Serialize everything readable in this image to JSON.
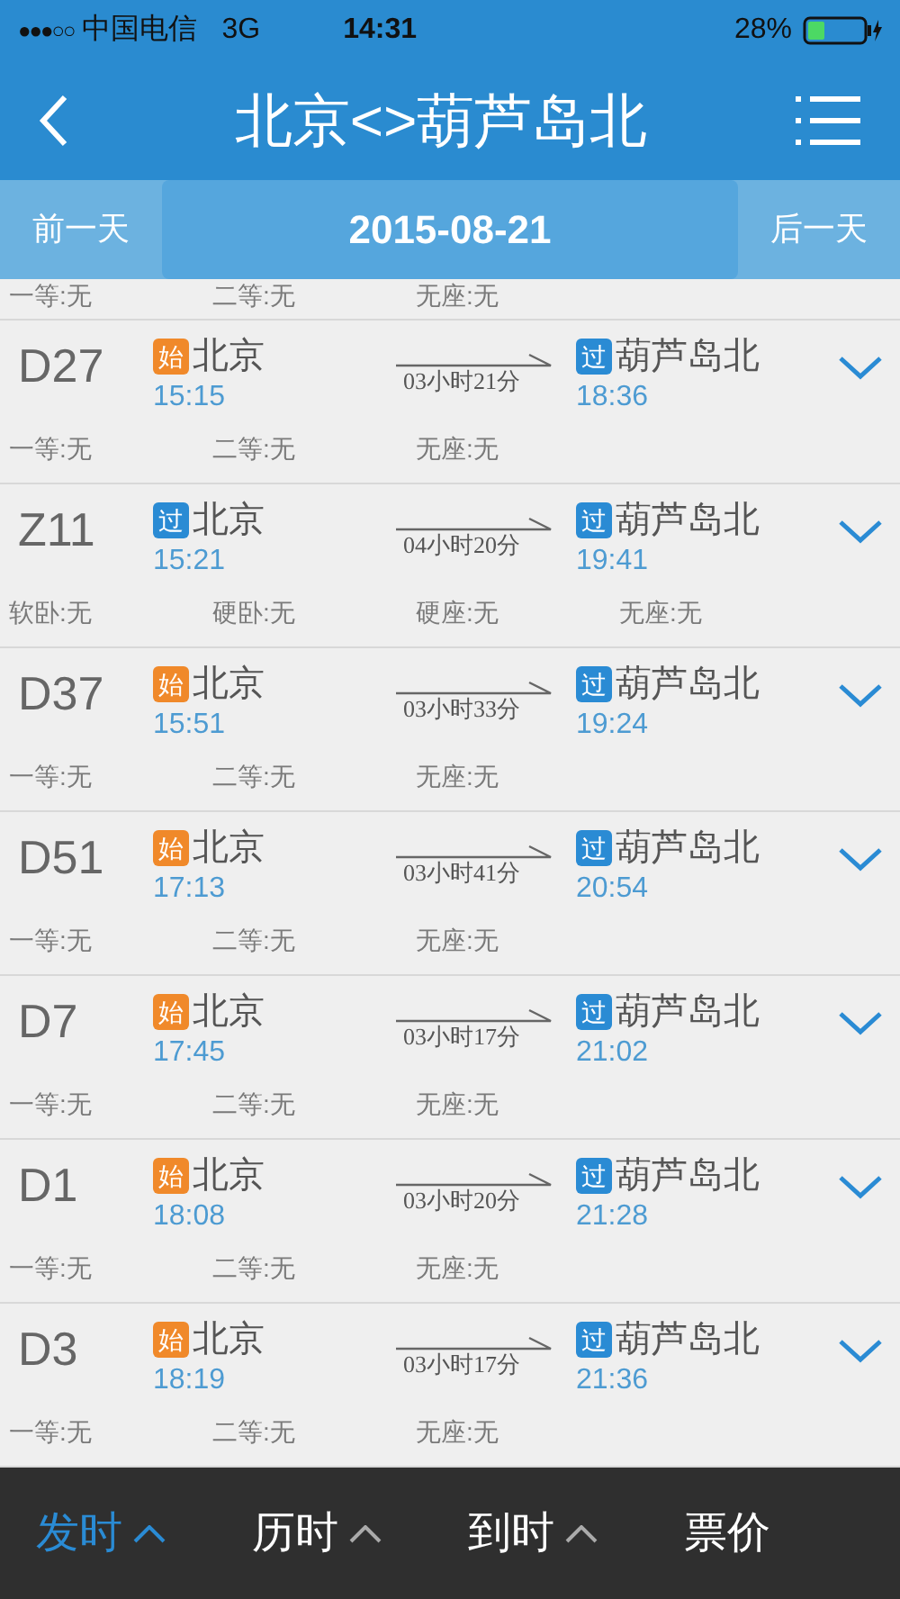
{
  "status_bar": {
    "signal": "●●●○○",
    "carrier": "中国电信",
    "network": "3G",
    "time": "14:31",
    "battery": "28%"
  },
  "nav": {
    "title": "北京<>葫芦岛北"
  },
  "date_bar": {
    "prev": "前一天",
    "date": "2015-08-21",
    "next": "后一天"
  },
  "partial_row": {
    "seats": [
      "一等:无",
      "二等:无",
      "无座:无"
    ]
  },
  "trains": [
    {
      "number": "D27",
      "from_badge": {
        "kind": "start",
        "text": "始"
      },
      "from": "北京",
      "depart": "15:15",
      "duration": "03小时21分",
      "to_badge": {
        "kind": "pass",
        "text": "过"
      },
      "to": "葫芦岛北",
      "arrive": "18:36",
      "seats": [
        "一等:无",
        "二等:无",
        "无座:无"
      ]
    },
    {
      "number": "Z11",
      "from_badge": {
        "kind": "pass",
        "text": "过"
      },
      "from": "北京",
      "depart": "15:21",
      "duration": "04小时20分",
      "to_badge": {
        "kind": "pass",
        "text": "过"
      },
      "to": "葫芦岛北",
      "arrive": "19:41",
      "seats": [
        "软卧:无",
        "硬卧:无",
        "硬座:无",
        "无座:无"
      ]
    },
    {
      "number": "D37",
      "from_badge": {
        "kind": "start",
        "text": "始"
      },
      "from": "北京",
      "depart": "15:51",
      "duration": "03小时33分",
      "to_badge": {
        "kind": "pass",
        "text": "过"
      },
      "to": "葫芦岛北",
      "arrive": "19:24",
      "seats": [
        "一等:无",
        "二等:无",
        "无座:无"
      ]
    },
    {
      "number": "D51",
      "from_badge": {
        "kind": "start",
        "text": "始"
      },
      "from": "北京",
      "depart": "17:13",
      "duration": "03小时41分",
      "to_badge": {
        "kind": "pass",
        "text": "过"
      },
      "to": "葫芦岛北",
      "arrive": "20:54",
      "seats": [
        "一等:无",
        "二等:无",
        "无座:无"
      ]
    },
    {
      "number": "D7",
      "from_badge": {
        "kind": "start",
        "text": "始"
      },
      "from": "北京",
      "depart": "17:45",
      "duration": "03小时17分",
      "to_badge": {
        "kind": "pass",
        "text": "过"
      },
      "to": "葫芦岛北",
      "arrive": "21:02",
      "seats": [
        "一等:无",
        "二等:无",
        "无座:无"
      ]
    },
    {
      "number": "D1",
      "from_badge": {
        "kind": "start",
        "text": "始"
      },
      "from": "北京",
      "depart": "18:08",
      "duration": "03小时20分",
      "to_badge": {
        "kind": "pass",
        "text": "过"
      },
      "to": "葫芦岛北",
      "arrive": "21:28",
      "seats": [
        "一等:无",
        "二等:无",
        "无座:无"
      ]
    },
    {
      "number": "D3",
      "from_badge": {
        "kind": "start",
        "text": "始"
      },
      "from": "北京",
      "depart": "18:19",
      "duration": "03小时17分",
      "to_badge": {
        "kind": "pass",
        "text": "过"
      },
      "to": "葫芦岛北",
      "arrive": "21:36",
      "seats": [
        "一等:无",
        "二等:无",
        "无座:无"
      ]
    }
  ],
  "sort_bar": [
    {
      "label": "发时",
      "selected": true,
      "caret": true
    },
    {
      "label": "历时",
      "selected": false,
      "caret": true
    },
    {
      "label": "到时",
      "selected": false,
      "caret": true
    },
    {
      "label": "票价",
      "selected": false,
      "caret": false
    }
  ]
}
